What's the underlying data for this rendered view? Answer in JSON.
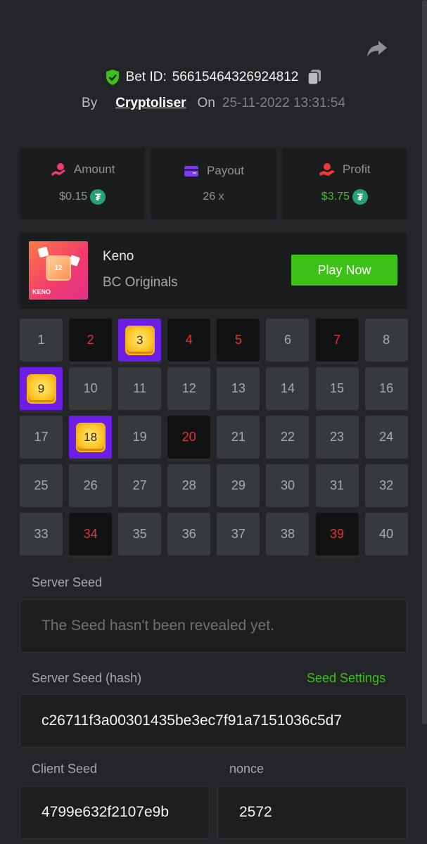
{
  "header": {
    "bet_label": "Bet ID:",
    "bet_id": "56615464326924812",
    "by_label": "By",
    "username": "Cryptoliser",
    "on_label": "On",
    "datetime": "25-11-2022 13:31:54"
  },
  "stats": {
    "amount": {
      "label": "Amount",
      "value": "$0.15",
      "icon": "amount-icon"
    },
    "payout": {
      "label": "Payout",
      "value": "26 x",
      "icon": "wallet-icon"
    },
    "profit": {
      "label": "Profit",
      "value": "$3.75",
      "icon": "profit-icon"
    },
    "currency_symbol": "₮"
  },
  "game": {
    "name": "Keno",
    "provider": "BC Originals",
    "thumb_label": "KENO",
    "thumb_number": "12",
    "play_label": "Play Now"
  },
  "keno": {
    "cells": [
      {
        "n": "1",
        "s": "idle"
      },
      {
        "n": "2",
        "s": "miss"
      },
      {
        "n": "3",
        "s": "hit"
      },
      {
        "n": "4",
        "s": "miss"
      },
      {
        "n": "5",
        "s": "miss"
      },
      {
        "n": "6",
        "s": "idle"
      },
      {
        "n": "7",
        "s": "miss"
      },
      {
        "n": "8",
        "s": "idle"
      },
      {
        "n": "9",
        "s": "hit"
      },
      {
        "n": "10",
        "s": "idle"
      },
      {
        "n": "11",
        "s": "idle"
      },
      {
        "n": "12",
        "s": "idle"
      },
      {
        "n": "13",
        "s": "idle"
      },
      {
        "n": "14",
        "s": "idle"
      },
      {
        "n": "15",
        "s": "idle"
      },
      {
        "n": "16",
        "s": "idle"
      },
      {
        "n": "17",
        "s": "idle"
      },
      {
        "n": "18",
        "s": "hit"
      },
      {
        "n": "19",
        "s": "idle"
      },
      {
        "n": "20",
        "s": "miss"
      },
      {
        "n": "21",
        "s": "idle"
      },
      {
        "n": "22",
        "s": "idle"
      },
      {
        "n": "23",
        "s": "idle"
      },
      {
        "n": "24",
        "s": "idle"
      },
      {
        "n": "25",
        "s": "idle"
      },
      {
        "n": "26",
        "s": "idle"
      },
      {
        "n": "27",
        "s": "idle"
      },
      {
        "n": "28",
        "s": "idle"
      },
      {
        "n": "29",
        "s": "idle"
      },
      {
        "n": "30",
        "s": "idle"
      },
      {
        "n": "31",
        "s": "idle"
      },
      {
        "n": "32",
        "s": "idle"
      },
      {
        "n": "33",
        "s": "idle"
      },
      {
        "n": "34",
        "s": "miss"
      },
      {
        "n": "35",
        "s": "idle"
      },
      {
        "n": "36",
        "s": "idle"
      },
      {
        "n": "37",
        "s": "idle"
      },
      {
        "n": "38",
        "s": "idle"
      },
      {
        "n": "39",
        "s": "miss"
      },
      {
        "n": "40",
        "s": "idle"
      }
    ]
  },
  "seeds": {
    "server_seed_label": "Server Seed",
    "server_seed_placeholder": "The Seed hasn't been revealed yet.",
    "server_hash_label": "Server Seed (hash)",
    "seed_settings_label": "Seed Settings",
    "server_hash_value": "c26711f3a00301435be3ec7f91a7151036c5d7",
    "client_seed_label": "Client Seed",
    "client_seed_value": "4799e632f2107e9b",
    "nonce_label": "nonce",
    "nonce_value": "2572"
  },
  "colors": {
    "accent_green": "#3bc117",
    "miss_red": "#e0342e",
    "hit_purple": "#6d1ee6",
    "background": "#232528"
  }
}
